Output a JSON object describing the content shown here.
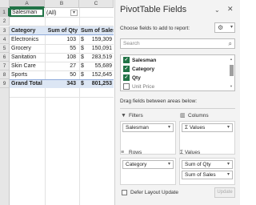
{
  "sheet": {
    "columns": [
      "A",
      "B",
      "C"
    ],
    "rows": [
      "1",
      "2",
      "3",
      "4",
      "5",
      "6",
      "7",
      "8",
      "9"
    ],
    "filter": {
      "label": "Salesman",
      "value": "(All)"
    },
    "headers": {
      "category": "Category",
      "qty": "Sum of Qty",
      "sales": "Sum of Sales"
    },
    "data": [
      {
        "category": "Electronics",
        "qty": "103",
        "currency": "$",
        "sales": "159,309"
      },
      {
        "category": "Grocery",
        "qty": "55",
        "currency": "$",
        "sales": "150,091"
      },
      {
        "category": "Sanitation",
        "qty": "108",
        "currency": "$",
        "sales": "283,519"
      },
      {
        "category": "Skin Care",
        "qty": "27",
        "currency": "$",
        "sales": "55,689"
      },
      {
        "category": "Sports",
        "qty": "50",
        "currency": "$",
        "sales": "152,645"
      }
    ],
    "total": {
      "label": "Grand Total",
      "qty": "343",
      "currency": "$",
      "sales": "801,253"
    }
  },
  "pane": {
    "title": "PivotTable Fields",
    "choose_label": "Choose fields to add to report:",
    "search_placeholder": "Search",
    "fields": [
      "Salesman",
      "Category",
      "Qty",
      "Unit Price"
    ],
    "drag_label": "Drag fields between areas below:",
    "filters": {
      "label": "Filters",
      "items": [
        "Salesman"
      ]
    },
    "columns": {
      "label": "Columns",
      "items": [
        "Σ Values"
      ]
    },
    "rows": {
      "label": "Rows",
      "items": [
        "Category"
      ]
    },
    "values": {
      "label": "Σ Values",
      "items": [
        "Sum of Qty",
        "Sum of Sales"
      ]
    },
    "defer_label": "Defer Layout Update",
    "update_label": "Update"
  },
  "colors": {
    "accent": "#217346",
    "pivot_header": "#dce6f4"
  }
}
